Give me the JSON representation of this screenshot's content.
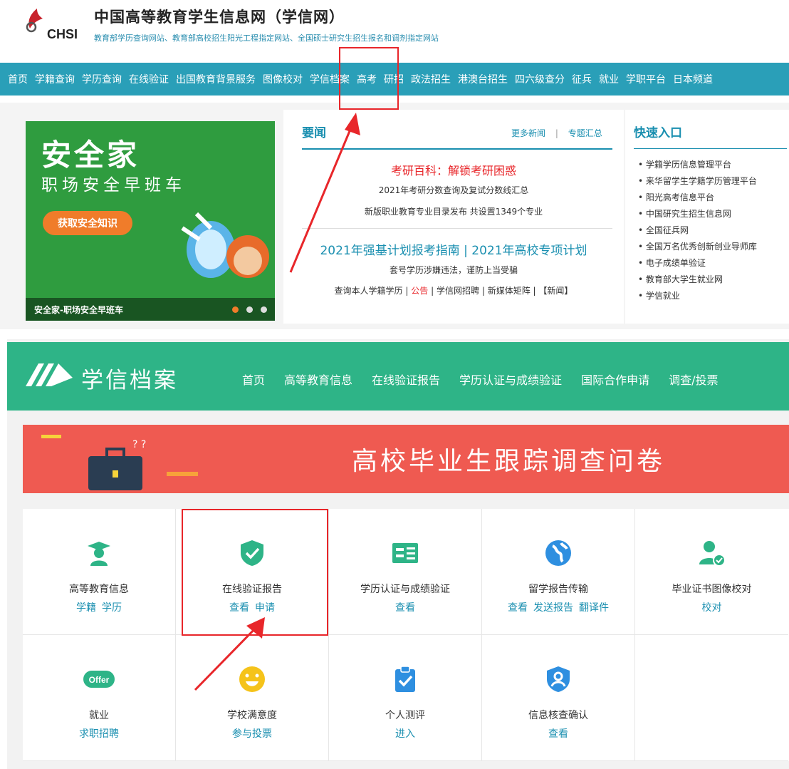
{
  "header": {
    "logo_text": "CHSI",
    "title": "中国高等教育学生信息网（学信网）",
    "subtitle": "教育部学历查询网站、教育部高校招生阳光工程指定网站、全国硕士研究生招生报名和调剂指定网站"
  },
  "top_nav": [
    "首页",
    "学籍查询",
    "学历查询",
    "在线验证",
    "出国教育背景服务",
    "图像校对",
    "学信档案",
    "高考",
    "研招",
    "政法招生",
    "港澳台招生",
    "四六级查分",
    "征兵",
    "就业",
    "学职平台",
    "日本频道"
  ],
  "banner": {
    "title": "安全家",
    "subtitle": "职场安全早班车",
    "button": "获取安全知识",
    "caption": "安全家-职场安全早班车"
  },
  "news": {
    "title": "要闻",
    "more": "更多新闻",
    "separator": "|",
    "topics": "专题汇总",
    "headline": "考研百科：解锁考研困惑",
    "line1": "2021年考研分数查询及复试分数线汇总",
    "line2": "新版职业教育专业目录发布 共设置1349个专业",
    "headline2": "2021年强基计划报考指南 | 2021年高校专项计划",
    "line3": "套号学历涉嫌违法，谨防上当受骗",
    "links": [
      "查询本人学籍学历",
      "|",
      "公告",
      "|",
      "学信网招聘",
      "|",
      "新媒体矩阵",
      "|",
      "【新闻】"
    ]
  },
  "quick": {
    "title": "快速入口",
    "items": [
      "• 学籍学历信息管理平台",
      "• 来华留学生学籍学历管理平台",
      "• 阳光高考信息平台",
      "• 中国研究生招生信息网",
      "• 全国征兵网",
      "• 全国万名优秀创新创业导师库",
      "• 电子成绩单验证",
      "• 教育部大学生就业网",
      "• 学信就业"
    ]
  },
  "xuexin": {
    "name": "学信档案",
    "nav": [
      "首页",
      "高等教育信息",
      "在线验证报告",
      "学历认证与成绩验证",
      "国际合作申请",
      "调查/投票"
    ]
  },
  "survey": {
    "title": "高校毕业生跟踪调查问卷"
  },
  "grid": [
    {
      "icon": "graduate-icon",
      "color": "#2eb487",
      "title": "高等教育信息",
      "actions": [
        "学籍",
        "学历"
      ]
    },
    {
      "icon": "shield-check-icon",
      "color": "#2eb487",
      "title": "在线验证报告",
      "actions": [
        "查看",
        "申请"
      ]
    },
    {
      "icon": "id-card-icon",
      "color": "#2eb487",
      "title": "学历认证与成绩验证",
      "actions": [
        "查看"
      ]
    },
    {
      "icon": "globe-icon",
      "color": "#2e8fe0",
      "title": "留学报告传输",
      "actions": [
        "查看",
        "发送报告",
        "翻译件"
      ]
    },
    {
      "icon": "user-check-icon",
      "color": "#2eb487",
      "title": "毕业证书图像校对",
      "actions": [
        "校对"
      ]
    },
    {
      "icon": "offer-icon",
      "color": "#2eb487",
      "title": "就业",
      "actions": [
        "求职招聘"
      ]
    },
    {
      "icon": "smile-icon",
      "color": "#f5c31a",
      "title": "学校满意度",
      "actions": [
        "参与投票"
      ]
    },
    {
      "icon": "clipboard-check-icon",
      "color": "#2e8fe0",
      "title": "个人测评",
      "actions": [
        "进入"
      ]
    },
    {
      "icon": "user-shield-icon",
      "color": "#2e8fe0",
      "title": "信息核查确认",
      "actions": [
        "查看"
      ]
    }
  ],
  "colors": {
    "teal_nav": "#2a9fb8",
    "green_bar": "#2eb487",
    "survey_red": "#ef5a51",
    "highlight": "#e8262a"
  }
}
